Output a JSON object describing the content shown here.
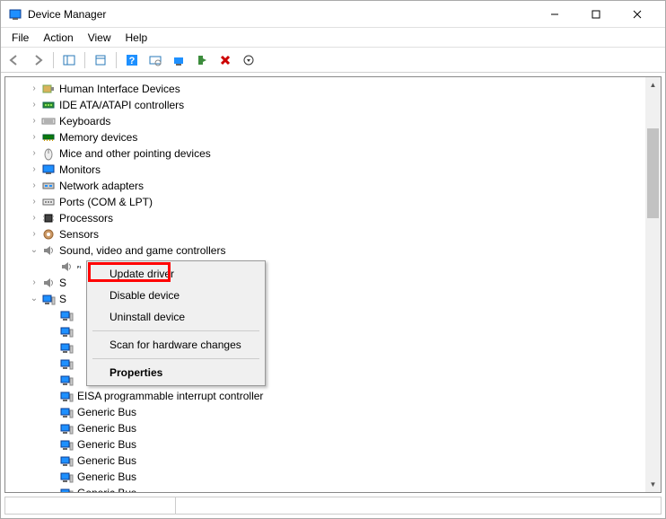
{
  "title": "Device Manager",
  "menu": {
    "file": "File",
    "action": "Action",
    "view": "View",
    "help": "Help"
  },
  "tree": {
    "items": [
      {
        "label": "Human Interface Devices",
        "icon": "hid",
        "exp": ">",
        "indent": 1
      },
      {
        "label": "IDE ATA/ATAPI controllers",
        "icon": "ide",
        "exp": ">",
        "indent": 1
      },
      {
        "label": "Keyboards",
        "icon": "kb",
        "exp": ">",
        "indent": 1
      },
      {
        "label": "Memory devices",
        "icon": "mem",
        "exp": ">",
        "indent": 1
      },
      {
        "label": "Mice and other pointing devices",
        "icon": "mouse",
        "exp": ">",
        "indent": 1
      },
      {
        "label": "Monitors",
        "icon": "mon",
        "exp": ">",
        "indent": 1
      },
      {
        "label": "Network adapters",
        "icon": "net",
        "exp": ">",
        "indent": 1
      },
      {
        "label": "Ports (COM & LPT)",
        "icon": "port",
        "exp": ">",
        "indent": 1
      },
      {
        "label": "Processors",
        "icon": "cpu",
        "exp": ">",
        "indent": 1
      },
      {
        "label": "Sensors",
        "icon": "sen",
        "exp": ">",
        "indent": 1
      },
      {
        "label": "Sound, video and game controllers",
        "icon": "snd",
        "exp": "v",
        "indent": 1
      },
      {
        "label": "",
        "icon": "snd",
        "exp": "",
        "indent": 2,
        "sel": true
      },
      {
        "label": "S",
        "icon": "snd",
        "exp": ">",
        "indent": 1
      },
      {
        "label": "S",
        "icon": "sys",
        "exp": "v",
        "indent": 1
      },
      {
        "label": "",
        "icon": "sys",
        "exp": "",
        "indent": 2
      },
      {
        "label": "",
        "icon": "sys",
        "exp": "",
        "indent": 2
      },
      {
        "label": "",
        "icon": "sys",
        "exp": "",
        "indent": 2
      },
      {
        "label": "",
        "icon": "sys",
        "exp": "",
        "indent": 2
      },
      {
        "label": "",
        "icon": "sys",
        "exp": "",
        "indent": 2
      },
      {
        "label": "EISA programmable interrupt controller",
        "icon": "sys",
        "exp": "",
        "indent": 2
      },
      {
        "label": "Generic Bus",
        "icon": "sys",
        "exp": "",
        "indent": 2
      },
      {
        "label": "Generic Bus",
        "icon": "sys",
        "exp": "",
        "indent": 2
      },
      {
        "label": "Generic Bus",
        "icon": "sys",
        "exp": "",
        "indent": 2
      },
      {
        "label": "Generic Bus",
        "icon": "sys",
        "exp": "",
        "indent": 2
      },
      {
        "label": "Generic Bus",
        "icon": "sys",
        "exp": "",
        "indent": 2
      },
      {
        "label": "Generic Bus",
        "icon": "sys",
        "exp": "",
        "indent": 2
      }
    ]
  },
  "context_menu": {
    "update": "Update driver",
    "disable": "Disable device",
    "uninstall": "Uninstall device",
    "scan": "Scan for hardware changes",
    "props": "Properties"
  }
}
